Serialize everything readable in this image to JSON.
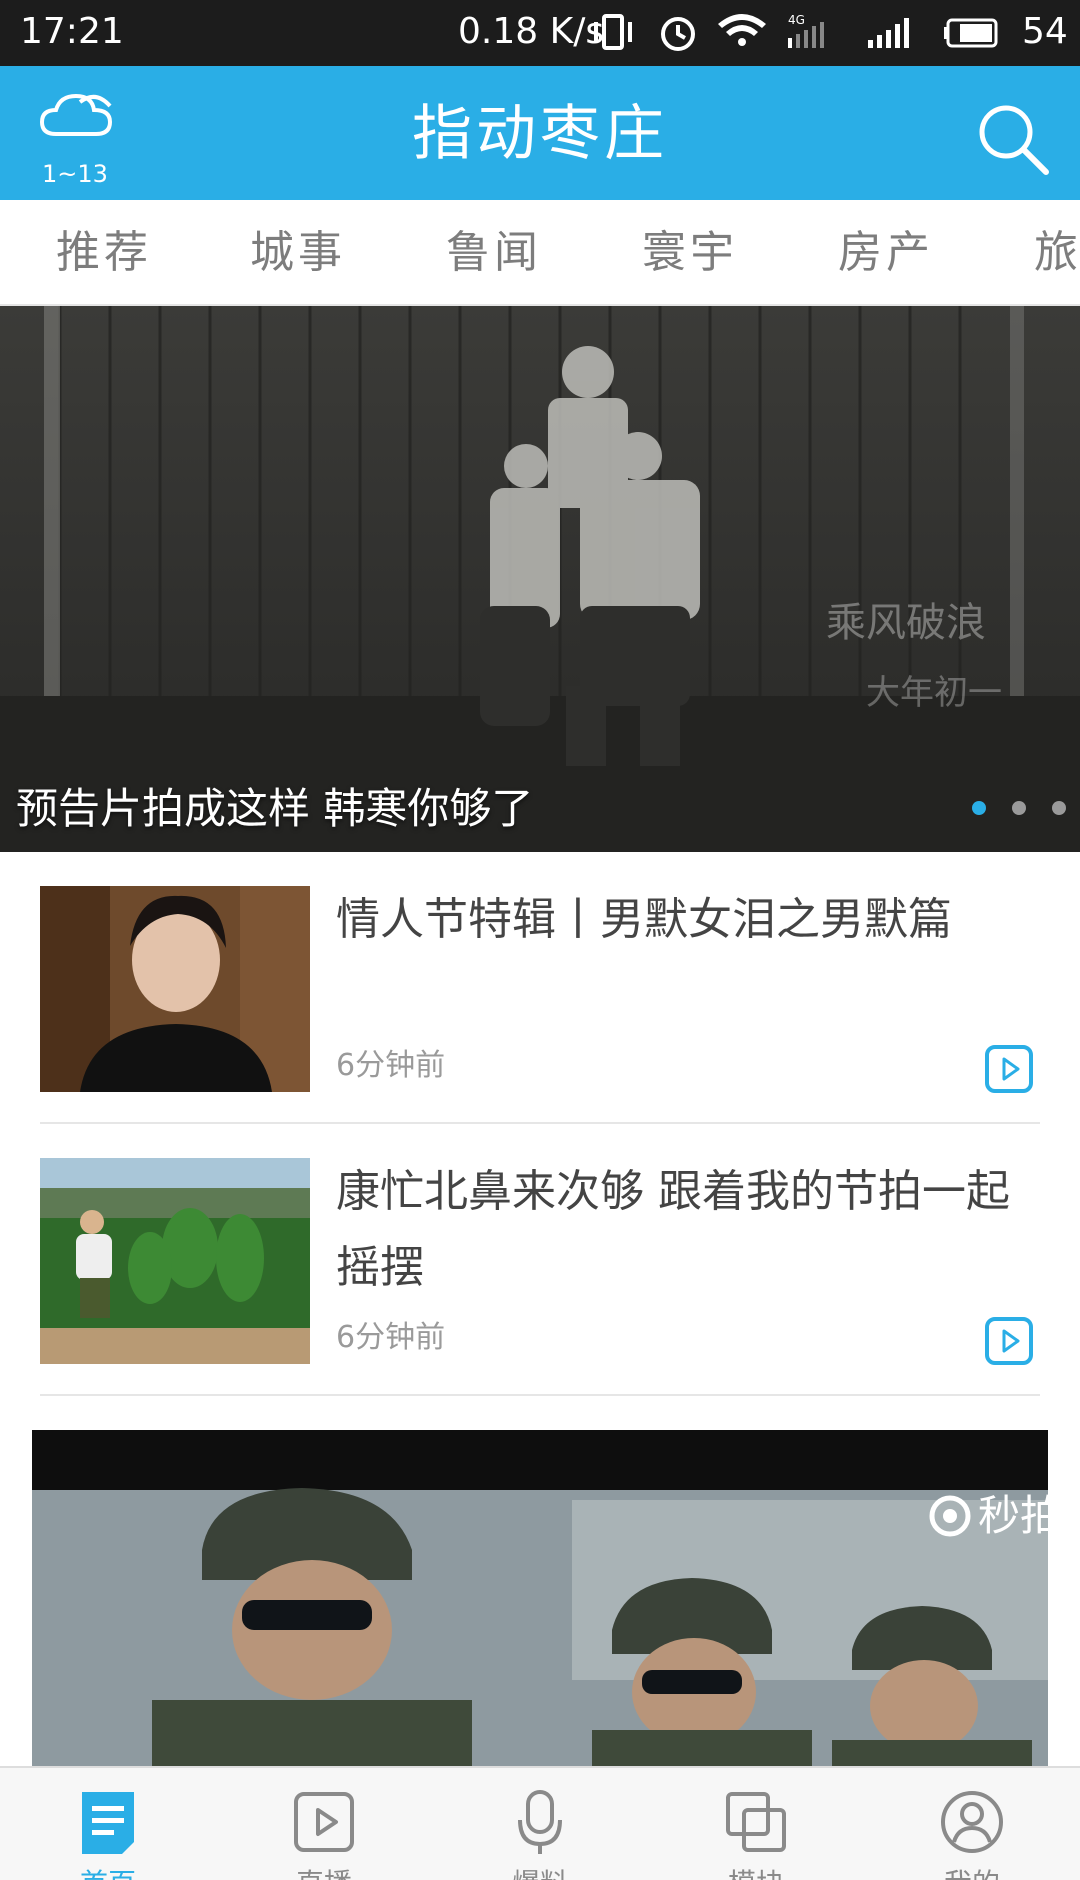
{
  "status_bar": {
    "time": "17:21",
    "network_speed": "0.18 K/s",
    "battery": "54"
  },
  "header": {
    "weather_icon": "cloud-icon",
    "weather_temp": "1~13",
    "title": "指动枣庄",
    "search_icon": "search-icon"
  },
  "tabs": [
    "推荐",
    "城事",
    "鲁闻",
    "寰宇",
    "房产",
    "旅"
  ],
  "banner": {
    "caption": "预告片拍成这样 韩寒你够了",
    "slides_total": 3,
    "active_slide": 1,
    "watermark_line1": "乘风破浪",
    "watermark_line2": "大年初一"
  },
  "news": [
    {
      "title": "情人节特辑丨男默女泪之男默篇",
      "time": "6分钟前",
      "icon": "play-icon"
    },
    {
      "title": "康忙北鼻来次够 跟着我的节拍一起摇摆",
      "time": "6分钟前",
      "icon": "play-icon"
    }
  ],
  "video_card": {
    "watermark": "秒拍"
  },
  "bottom_nav": [
    {
      "label": "首页",
      "icon": "home-doc-icon",
      "active": true
    },
    {
      "label": "直播",
      "icon": "play-square-icon",
      "active": false
    },
    {
      "label": "爆料",
      "icon": "microphone-icon",
      "active": false
    },
    {
      "label": "模块",
      "icon": "layers-icon",
      "active": false
    },
    {
      "label": "我的",
      "icon": "user-icon",
      "active": false
    }
  ],
  "colors": {
    "brand": "#2aaee6",
    "status_bar": "#1c1c1c",
    "tab_text": "#7d7d7d"
  }
}
